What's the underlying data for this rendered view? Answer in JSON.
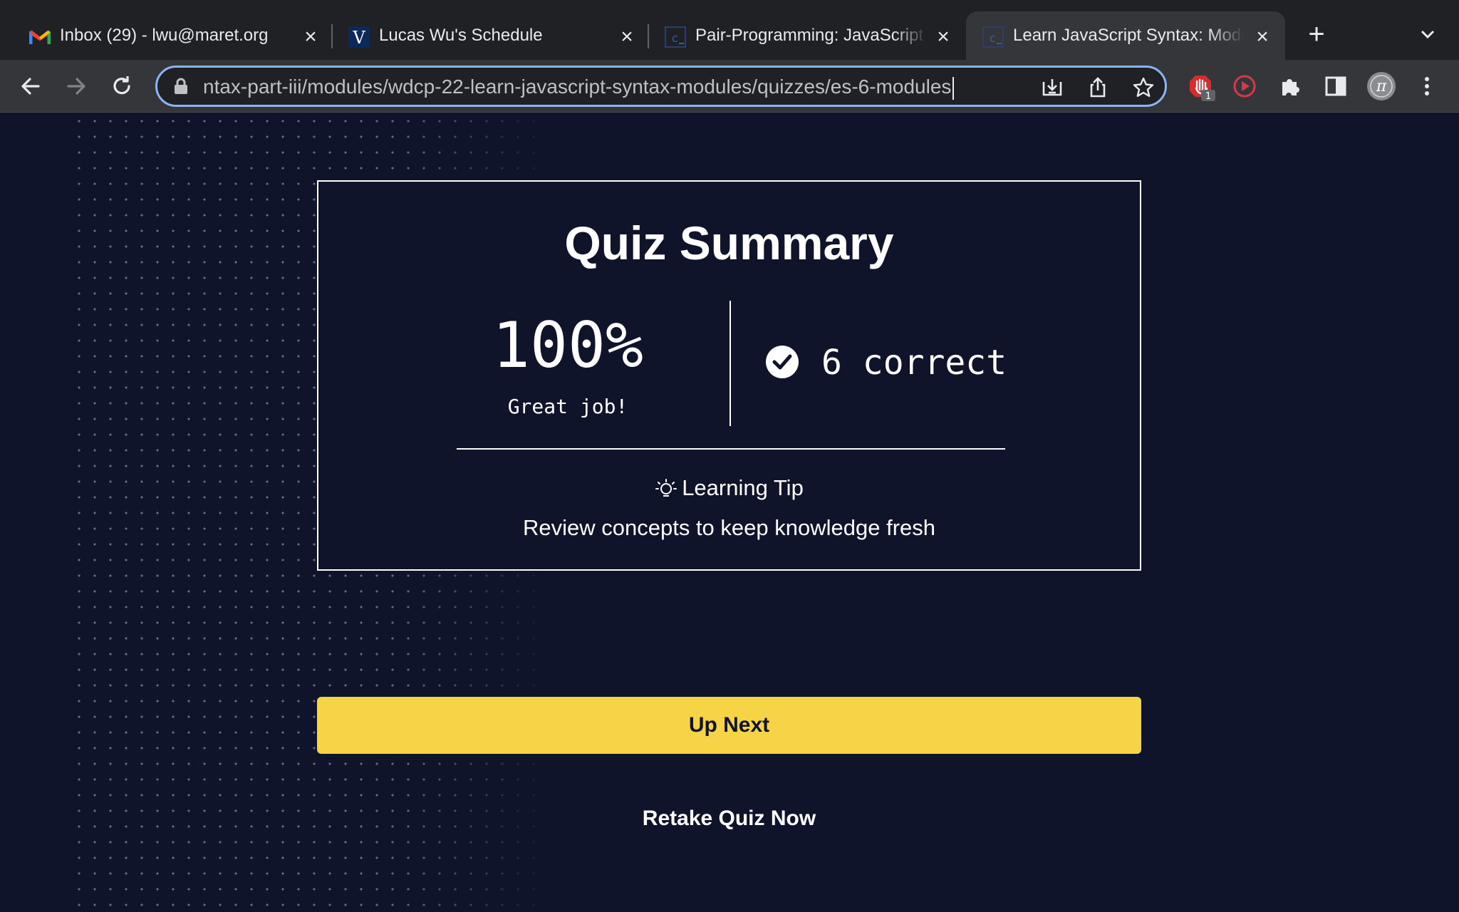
{
  "browser": {
    "tabs": [
      {
        "title": "Inbox (29) - lwu@maret.org",
        "favicon": "gmail-icon",
        "active": false
      },
      {
        "title": "Lucas Wu's Schedule",
        "favicon": "veracross-icon",
        "active": false
      },
      {
        "title": "Pair-Programming: JavaScript",
        "favicon": "codecademy-icon",
        "active": false
      },
      {
        "title": "Learn JavaScript Syntax: Modules",
        "favicon": "codecademy-icon",
        "active": true
      }
    ],
    "address_bar": {
      "url": "ntax-part-iii/modules/wdcp-22-learn-javascript-syntax-modules/quizzes/es-6-modules"
    },
    "extension_badge": "1",
    "colors": {
      "tabbar": "#202124",
      "toolbar": "#35363a",
      "focus_ring": "#8ab4f8"
    }
  },
  "quiz": {
    "title": "Quiz Summary",
    "score_percent": "100%",
    "score_message": "Great job!",
    "correct_summary": "6 correct",
    "tip_label": "Learning Tip",
    "tip_text": "Review concepts to keep knowledge fresh"
  },
  "actions": {
    "up_next": "Up Next",
    "retake": "Retake Quiz Now"
  },
  "colors": {
    "page_background": "#10142b",
    "primary_button": "#f7d445",
    "text": "#ffffff"
  }
}
